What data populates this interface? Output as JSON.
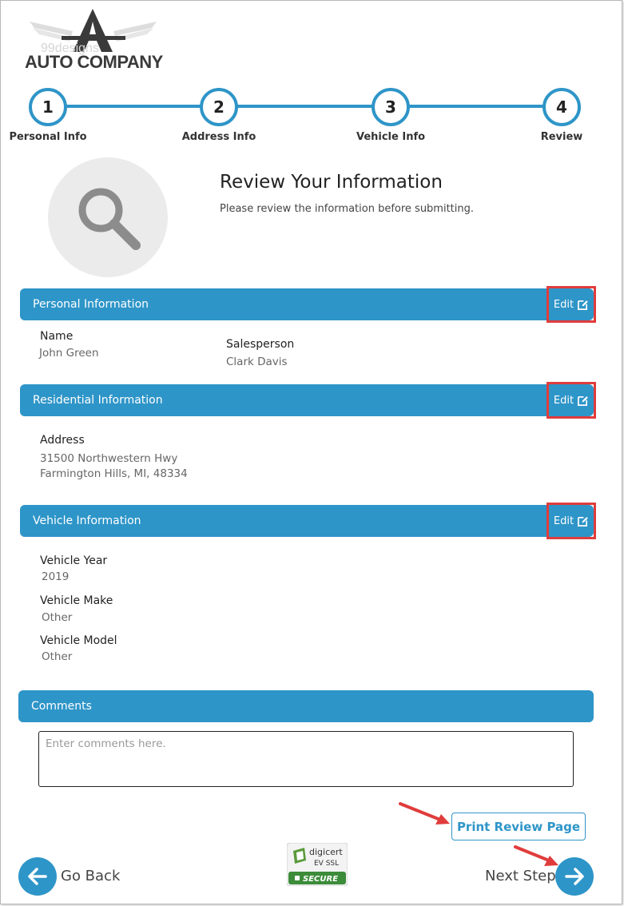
{
  "brand": {
    "name": "AUTO COMPANY",
    "watermark": "99designs"
  },
  "steps": [
    {
      "number": "1",
      "label": "Personal Info"
    },
    {
      "number": "2",
      "label": "Address Info"
    },
    {
      "number": "3",
      "label": "Vehicle Info"
    },
    {
      "number": "4",
      "label": "Review"
    }
  ],
  "header": {
    "title": "Review Your Information",
    "subtitle": "Please review the information before submitting."
  },
  "sections": {
    "personal": {
      "title": "Personal Information",
      "edit_label": "Edit",
      "name_label": "Name",
      "name_value": "John Green",
      "salesperson_label": "Salesperson",
      "salesperson_value": "Clark Davis"
    },
    "residential": {
      "title": "Residential Information",
      "edit_label": "Edit",
      "address_label": "Address",
      "address_line1": "31500 Northwestern Hwy",
      "address_line2": "Farmington Hills, MI, 48334"
    },
    "vehicle": {
      "title": "Vehicle Information",
      "edit_label": "Edit",
      "year_label": "Vehicle Year",
      "year_value": "2019",
      "make_label": "Vehicle Make",
      "make_value": "Other",
      "model_label": "Vehicle Model",
      "model_value": "Other"
    },
    "comments": {
      "title": "Comments",
      "placeholder": "Enter comments here."
    }
  },
  "actions": {
    "print_label": "Print Review Page",
    "back_label": "Go Back",
    "next_label": "Next Step"
  },
  "badge": {
    "brand": "digicert",
    "type": "EV SSL",
    "status": "SECURE"
  },
  "colors": {
    "accent": "#2e95c8",
    "highlight": "#e03c3c"
  }
}
